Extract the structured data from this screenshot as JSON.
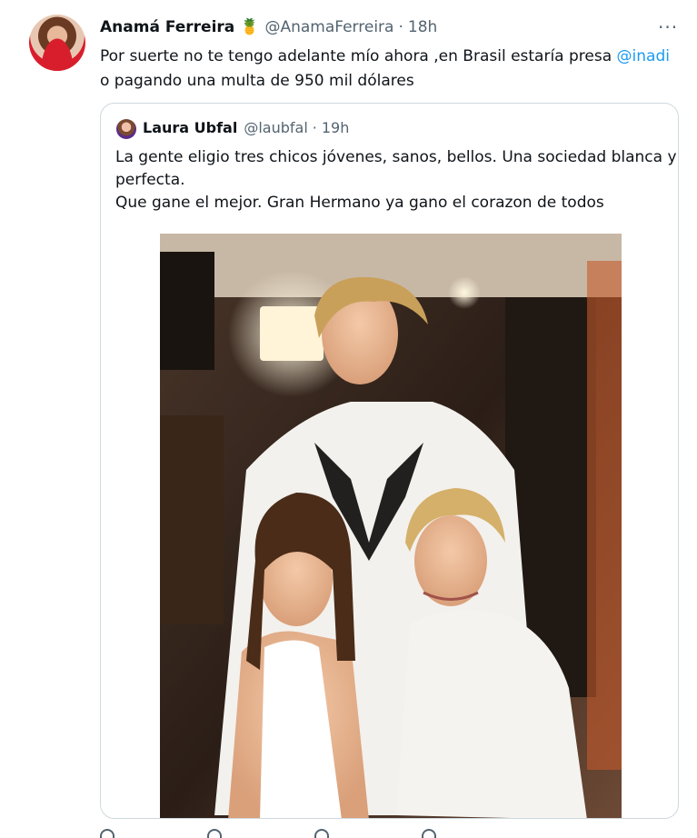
{
  "tweet": {
    "author_name": "Anamá Ferreira",
    "author_emoji": "🍍",
    "author_handle": "@AnamaFerreira",
    "separator": "·",
    "time": "18h",
    "more_icon": "···",
    "text_before": "Por suerte no te tengo adelante mío ahora ,en Brasil estaría presa ",
    "mention": "@inadi",
    "text_after": " o pagando una multa de 950 mil dólares"
  },
  "quote": {
    "author_name": "Laura Ubfal",
    "author_handle": "@laubfal",
    "separator": "·",
    "time": "19h",
    "lines": [
      "La gente eligio tres chicos jóvenes, sanos, bellos. Una sociedad blanca y",
      "perfecta.",
      "Que gane el mejor. Gran Hermano ya gano el corazon de todos"
    ]
  },
  "actions": {
    "icons": [
      "reply-icon",
      "retweet-icon",
      "like-icon",
      "share-icon"
    ]
  }
}
